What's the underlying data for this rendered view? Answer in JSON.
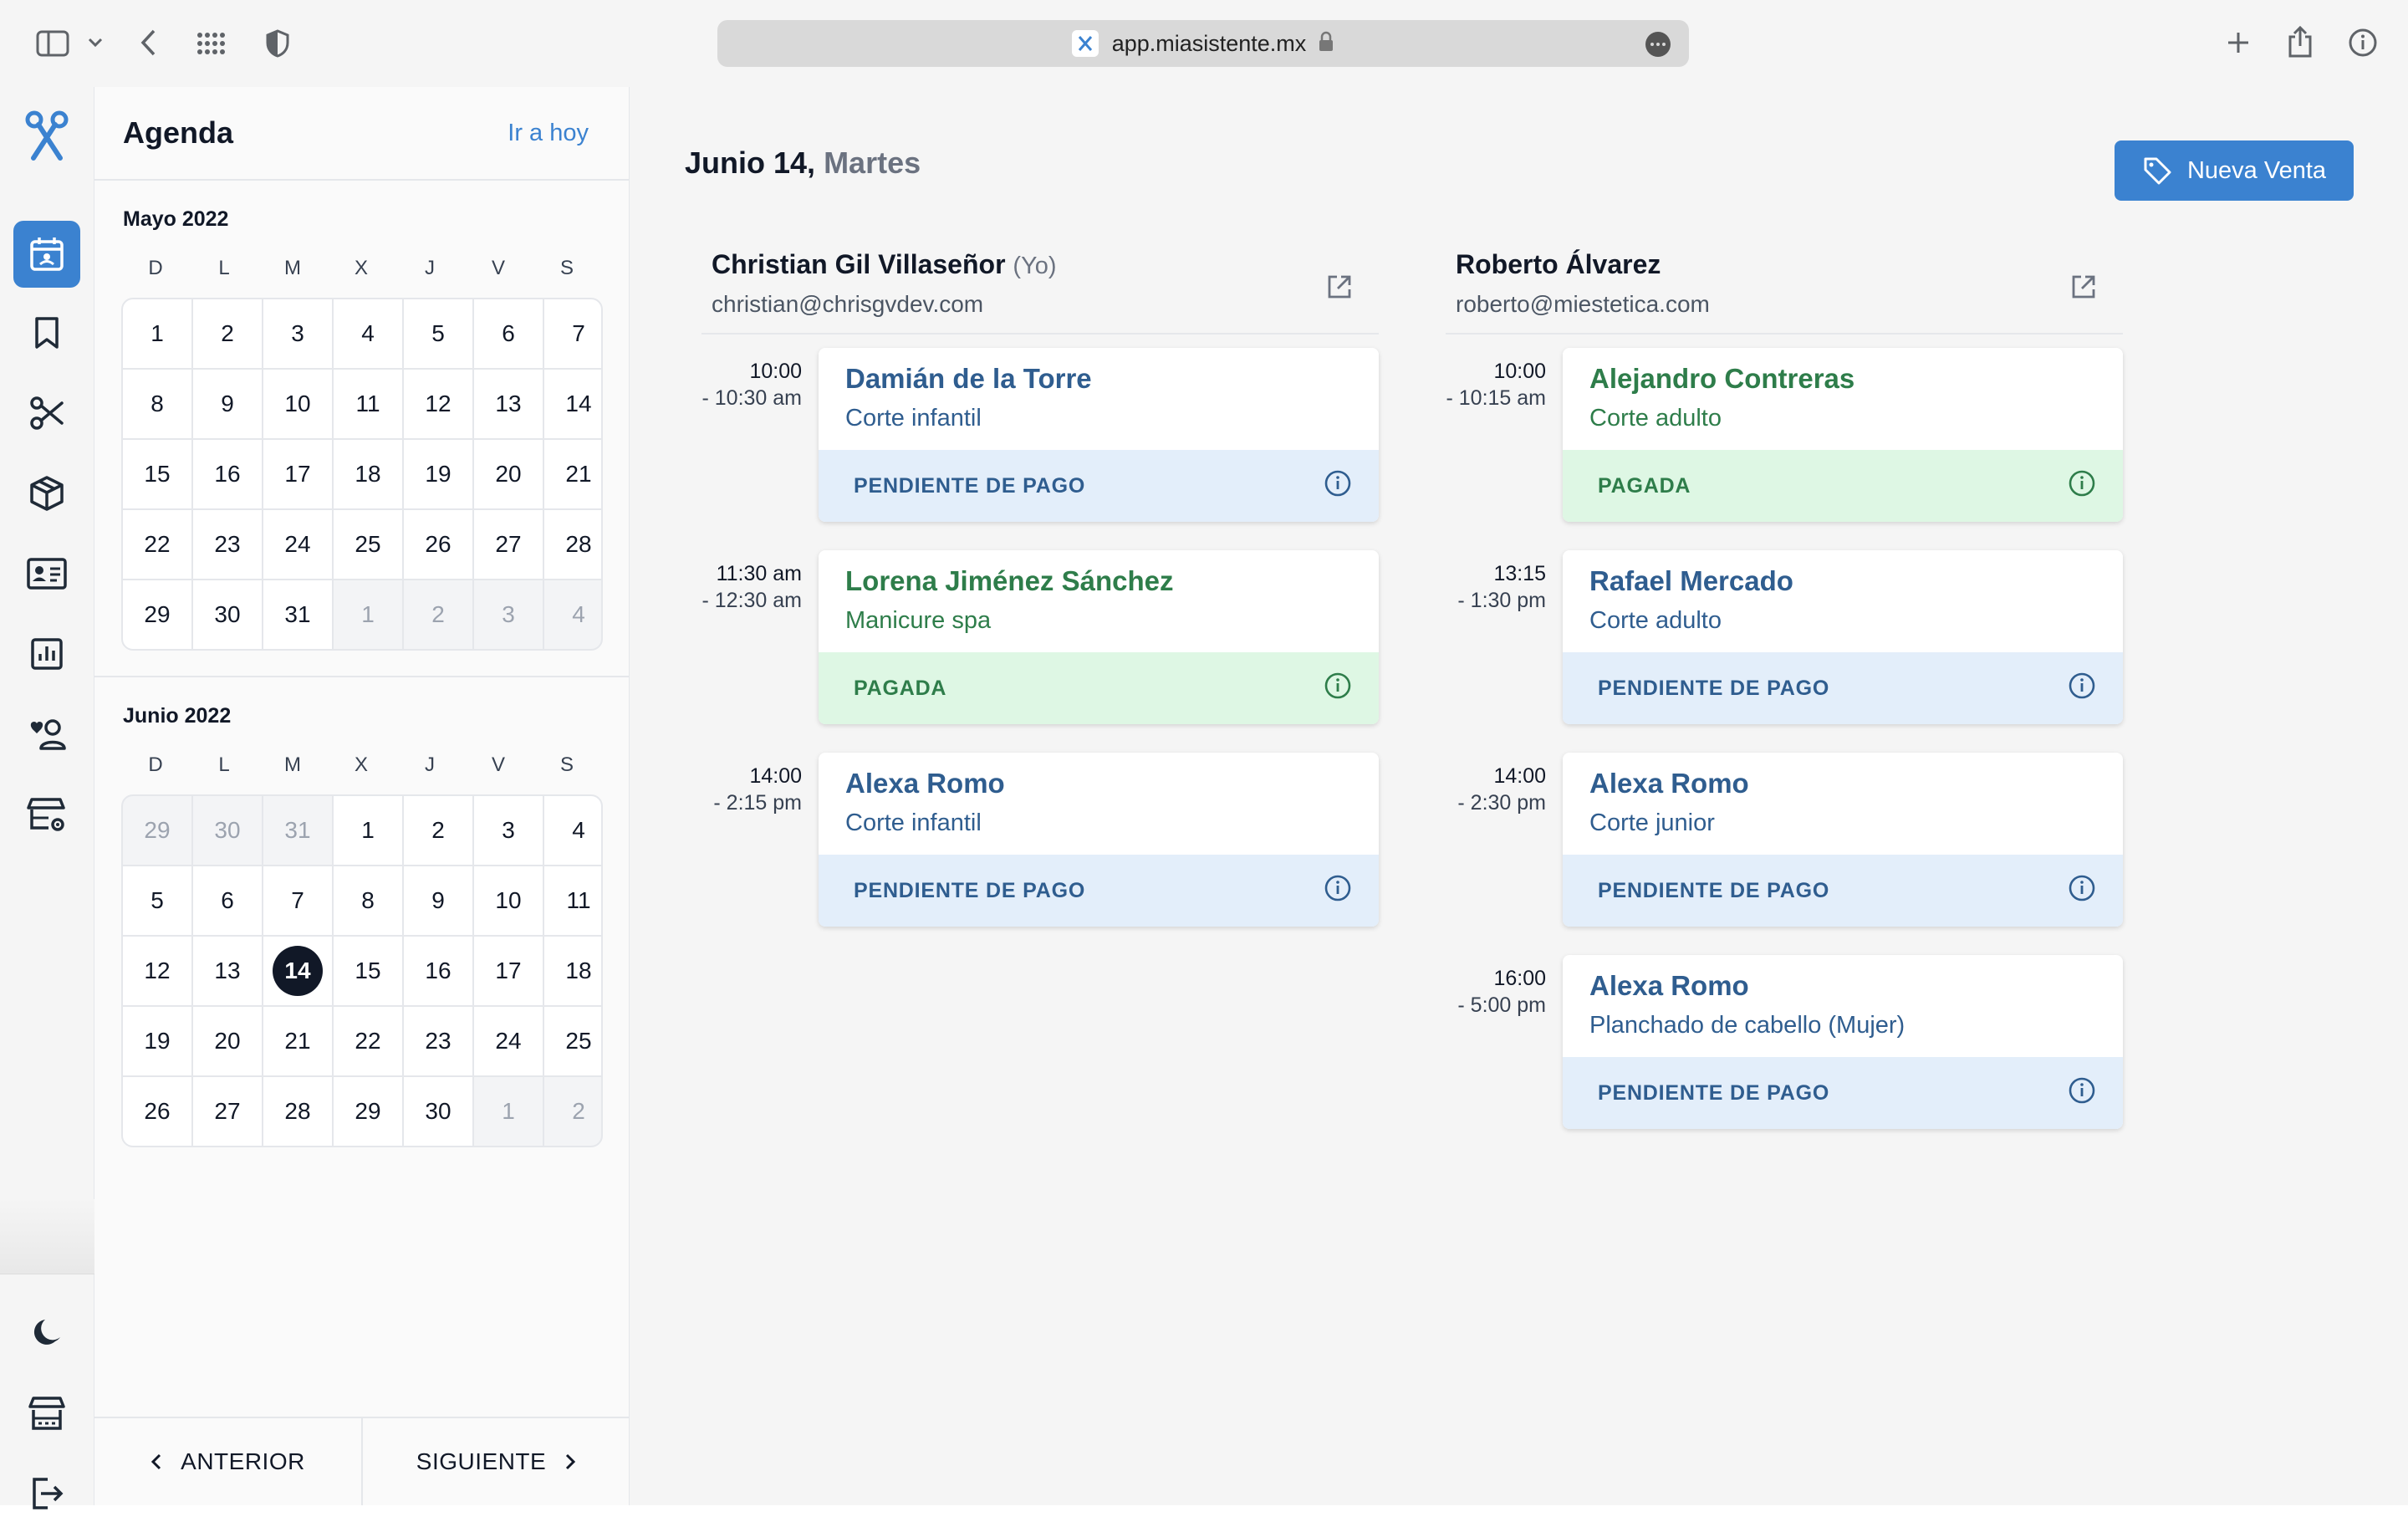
{
  "browser": {
    "url": "app.miasistente.mx"
  },
  "sidebar": {
    "items": [
      {
        "icon": "calendar-icon",
        "active": true
      },
      {
        "icon": "bookmark-icon",
        "active": false
      },
      {
        "icon": "scissors-icon",
        "active": false
      },
      {
        "icon": "box-icon",
        "active": false
      },
      {
        "icon": "id-card-icon",
        "active": false
      },
      {
        "icon": "chart-icon",
        "active": false
      },
      {
        "icon": "client-icon",
        "active": false
      },
      {
        "icon": "store-settings-icon",
        "active": false
      }
    ],
    "bottom": [
      "moon-icon",
      "store-icon",
      "logout-icon"
    ]
  },
  "calendar": {
    "title": "Agenda",
    "today_link": "Ir a hoy",
    "weekdays": [
      "D",
      "L",
      "M",
      "X",
      "J",
      "V",
      "S"
    ],
    "months": [
      {
        "title": "Mayo 2022",
        "days": [
          "1",
          "2",
          "3",
          "4",
          "5",
          "6",
          "7",
          "8",
          "9",
          "10",
          "11",
          "12",
          "13",
          "14",
          "15",
          "16",
          "17",
          "18",
          "19",
          "20",
          "21",
          "22",
          "23",
          "24",
          "25",
          "26",
          "27",
          "28",
          "29",
          "30",
          "31",
          "1",
          "2",
          "3",
          "4"
        ],
        "muted_from": 31
      },
      {
        "title": "Junio 2022",
        "days": [
          "29",
          "30",
          "31",
          "1",
          "2",
          "3",
          "4",
          "5",
          "6",
          "7",
          "8",
          "9",
          "10",
          "11",
          "12",
          "13",
          "14",
          "15",
          "16",
          "17",
          "18",
          "19",
          "20",
          "21",
          "22",
          "23",
          "24",
          "25",
          "26",
          "27",
          "28",
          "29",
          "30",
          "1",
          "2"
        ],
        "muted_before": 3,
        "muted_from": 33,
        "selected": 16
      }
    ],
    "prev_label": "ANTERIOR",
    "next_label": "SIGUIENTE"
  },
  "main": {
    "date": "Junio 14,",
    "weekday": "Martes",
    "new_sale_label": "Nueva Venta",
    "columns": [
      {
        "name": "Christian Gil Villaseñor",
        "me": "(Yo)",
        "email": "christian@chrisgvdev.com",
        "appointments": [
          {
            "start": "10:00",
            "end": "- 10:30 am",
            "client": "Damián de la Torre",
            "service": "Corte infantil",
            "status": "PENDIENTE DE PAGO",
            "paid": false
          },
          {
            "start": "11:30 am",
            "end": "- 12:30 am",
            "client": "Lorena Jiménez Sánchez",
            "service": "Manicure spa",
            "status": "PAGADA",
            "paid": true
          },
          {
            "start": "14:00",
            "end": "- 2:15 pm",
            "client": "Alexa Romo",
            "service": "Corte infantil",
            "status": "PENDIENTE DE PAGO",
            "paid": false
          }
        ]
      },
      {
        "name": "Roberto Álvarez",
        "me": "",
        "email": "roberto@miestetica.com",
        "appointments": [
          {
            "start": "10:00",
            "end": "- 10:15 am",
            "client": "Alejandro Contreras",
            "service": "Corte adulto",
            "status": "PAGADA",
            "paid": true
          },
          {
            "start": "13:15",
            "end": "- 1:30 pm",
            "client": "Rafael Mercado",
            "service": "Corte adulto",
            "status": "PENDIENTE DE PAGO",
            "paid": false
          },
          {
            "start": "14:00",
            "end": "- 2:30 pm",
            "client": "Alexa Romo",
            "service": "Corte junior",
            "status": "PENDIENTE DE PAGO",
            "paid": false
          },
          {
            "start": "16:00",
            "end": "- 5:00 pm",
            "client": "Alexa Romo",
            "service": "Planchado de cabello (Mujer)",
            "status": "PENDIENTE DE PAGO",
            "paid": false
          }
        ]
      }
    ]
  }
}
